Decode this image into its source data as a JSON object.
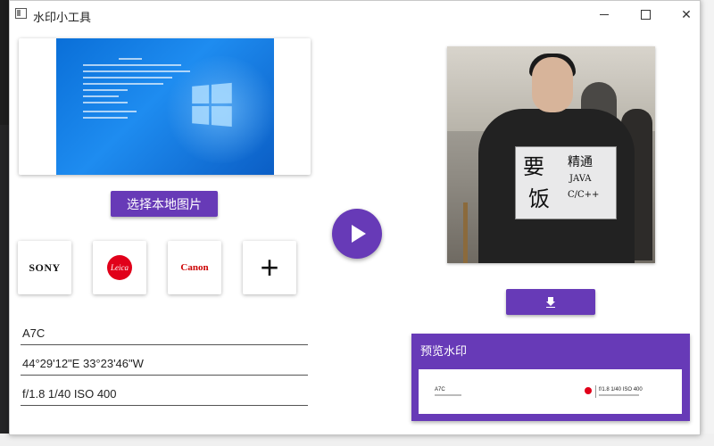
{
  "window": {
    "title": "水印小工具"
  },
  "actions": {
    "choose_image_label": "选择本地图片"
  },
  "logos": [
    {
      "name": "SONY"
    },
    {
      "name": "Leica"
    },
    {
      "name": "Canon"
    },
    {
      "name": "+"
    }
  ],
  "fields": {
    "model": "A7C",
    "coordinates": "44°29'12\"E 33°23'46\"W",
    "params": "f/1.8 1/40 ISO 400"
  },
  "preview": {
    "title": "预览水印",
    "model": "A7C",
    "params": "f/1.8 1/40 ISO 400"
  },
  "photo": {
    "sign_big_1": "要",
    "sign_big_2": "饭",
    "sign_small_1": "精通",
    "sign_small_2": "JAVA",
    "sign_small_3": "C/C++"
  },
  "colors": {
    "accent": "#673ab7",
    "leica_red": "#e1001a",
    "canon_red": "#cc0000"
  }
}
